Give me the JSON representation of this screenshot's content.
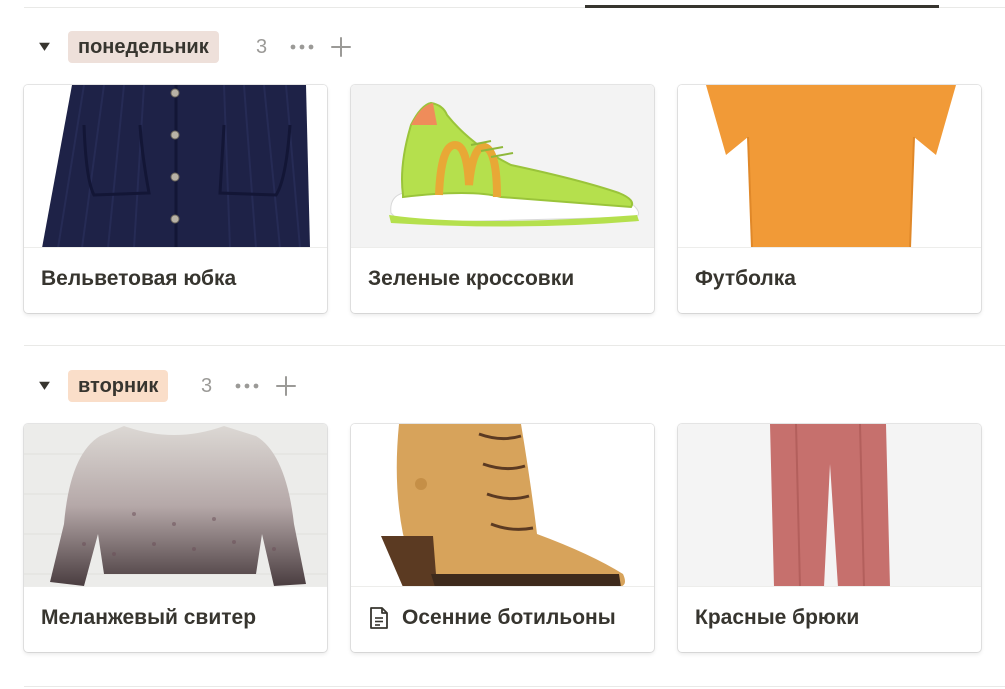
{
  "groups": [
    {
      "tag": "понедельник",
      "tag_color": "#eee0da",
      "count": "3",
      "cards": [
        {
          "title": "Вельветовая юбка",
          "image": "navy-corduroy-skirt",
          "color": "#1e2247"
        },
        {
          "title": "Зеленые кроссовки",
          "image": "green-sneaker",
          "color": "#b5e04d"
        },
        {
          "title": "Футболка",
          "image": "orange-tshirt",
          "color": "#f19a37"
        }
      ]
    },
    {
      "tag": "вторник",
      "tag_color": "#fadec9",
      "count": "3",
      "cards": [
        {
          "title": "Меланжевый свитер",
          "image": "melange-sweater",
          "color": "#8c8088"
        },
        {
          "title": "Осенние ботильоны",
          "image": "tan-boot",
          "color": "#d7a35b",
          "icon": "page-icon"
        },
        {
          "title": "Красные брюки",
          "image": "pink-trousers",
          "color": "#c6706d"
        }
      ]
    }
  ],
  "icons": {
    "toggle": "triangle-down-icon",
    "more": "more-dots-icon",
    "add": "plus-icon"
  }
}
